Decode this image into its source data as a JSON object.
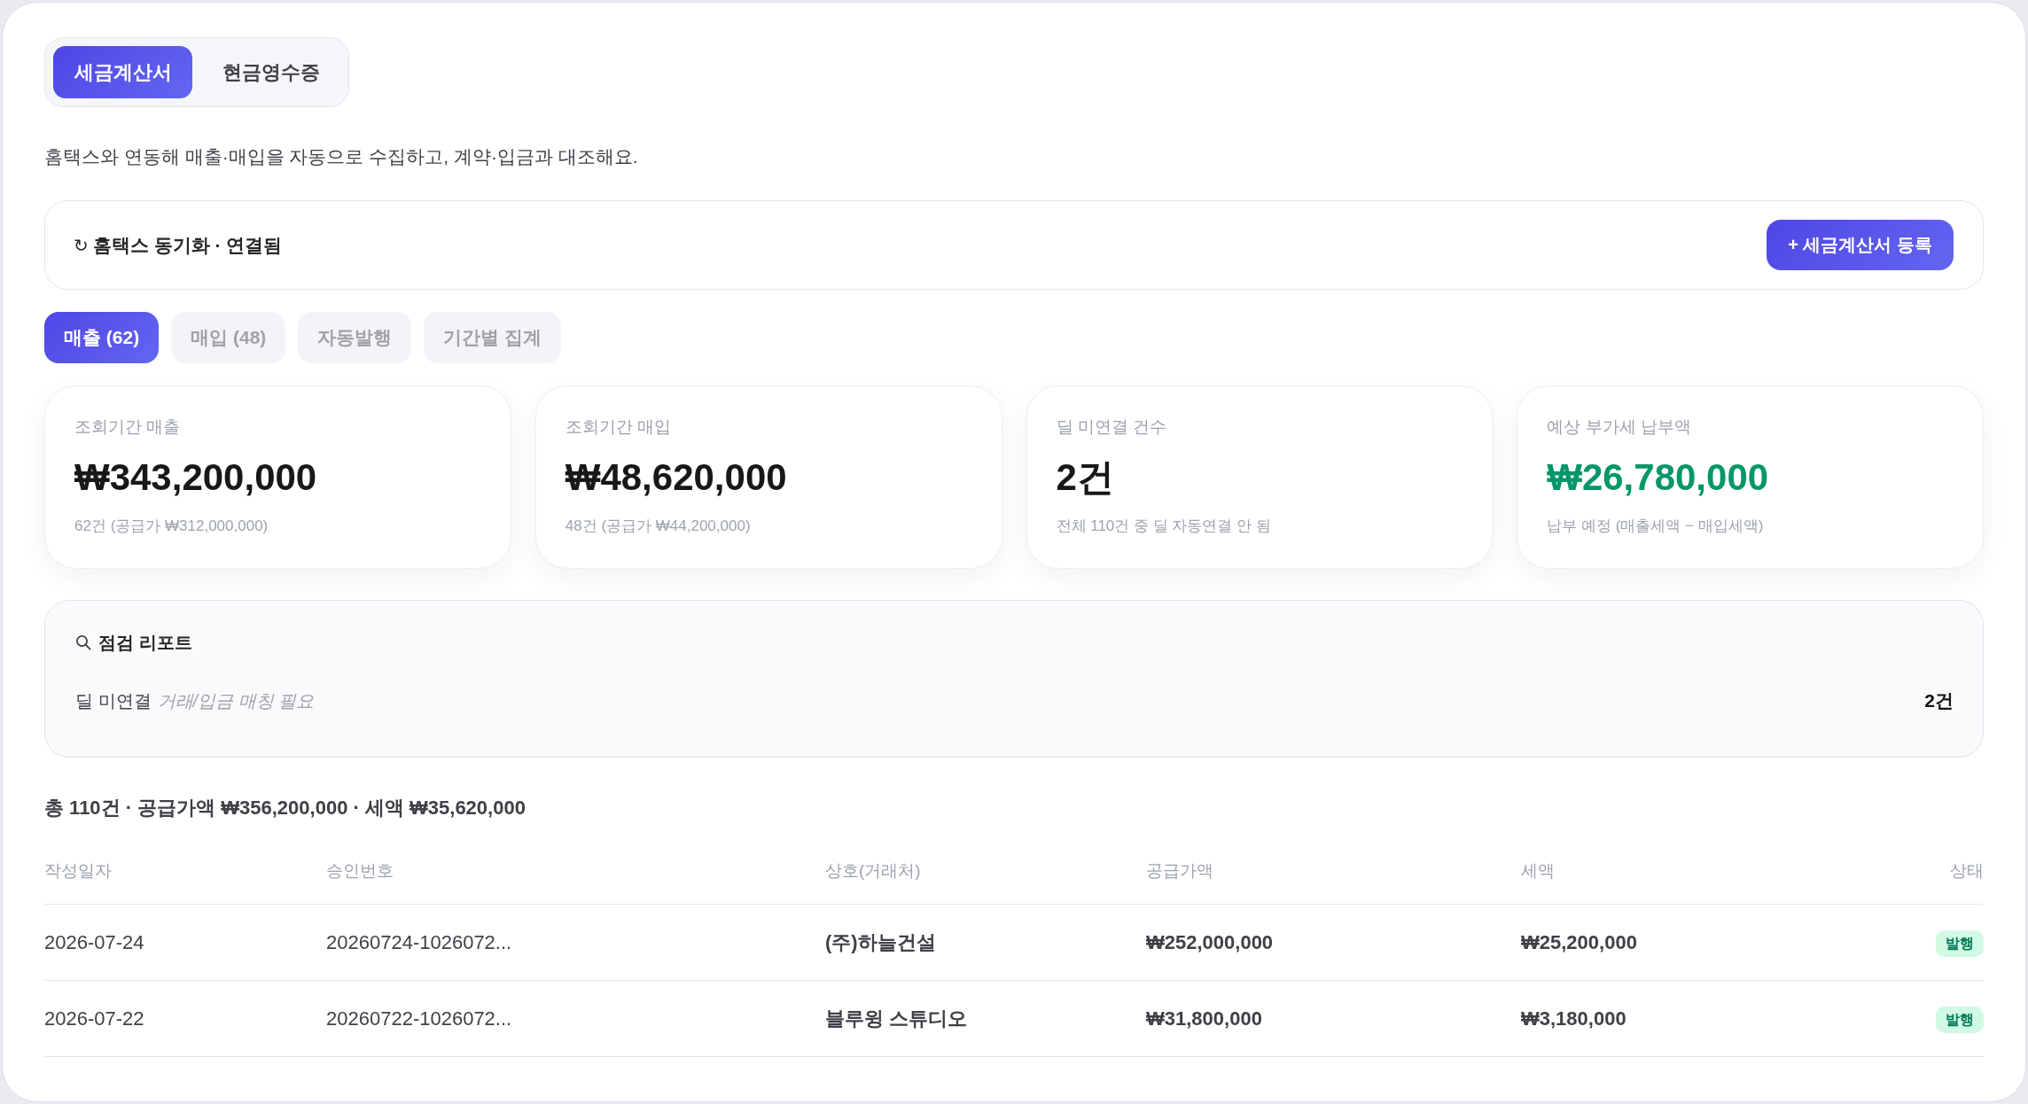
{
  "doc_tabs": [
    {
      "label": "세금계산서",
      "selected": true
    },
    {
      "label": "현금영수증",
      "selected": false
    }
  ],
  "description": "홈택스와 연동해 매출·매입을 자동으로 수집하고, 계약·입금과 대조해요.",
  "sync_bar": {
    "icon": "↻",
    "status": "홈택스 동기화 · 연결됨",
    "button": "+ 세금계산서 등록"
  },
  "view_tabs": [
    {
      "label": "매출 (62)",
      "selected": true
    },
    {
      "label": "매입 (48)",
      "selected": false
    },
    {
      "label": "자동발행",
      "selected": false
    },
    {
      "label": "기간별 집계",
      "selected": false
    }
  ],
  "stats": [
    {
      "label": "조회기간 매출",
      "value": "₩343,200,000",
      "note": "62건 (공급가 ₩312,000,000)",
      "kind": "neutral"
    },
    {
      "label": "조회기간 매입",
      "value": "₩48,620,000",
      "note": "48건 (공급가 ₩44,200,000)",
      "kind": "neutral"
    },
    {
      "label": "딜 미연결 건수",
      "value": "2건",
      "note": "전체 110건 중 딜 자동연결 안 됨",
      "kind": "neutral"
    },
    {
      "label": "예상 부가세 납부액",
      "value": "₩26,780,000",
      "note": "납부 예정 (매출세액 − 매입세액)",
      "kind": "positive"
    }
  ],
  "report": {
    "title": "점검 리포트",
    "items": [
      {
        "label": "딜 미연결",
        "hint": "거래/입금 매칭 필요",
        "count": "2건"
      }
    ]
  },
  "summary": "총 110건 · 공급가액 ₩356,200,000 · 세액 ₩35,620,000",
  "table": {
    "columns": [
      "작성일자",
      "승인번호",
      "상호(거래처)",
      "공급가액",
      "세액",
      "상태"
    ],
    "rows": [
      {
        "date": "2026-07-24",
        "approval_no": "20260724-1026072...",
        "company": "(주)하늘건설",
        "supply_amount": "₩252,000,000",
        "tax": "₩25,200,000",
        "status": {
          "label": "발행",
          "kind": "issued"
        }
      },
      {
        "date": "2026-07-22",
        "approval_no": "20260722-1026072...",
        "company": "블루윙 스튜디오",
        "supply_amount": "₩31,800,000",
        "tax": "₩3,180,000",
        "status": {
          "label": "발행",
          "kind": "issued"
        }
      }
    ]
  }
}
